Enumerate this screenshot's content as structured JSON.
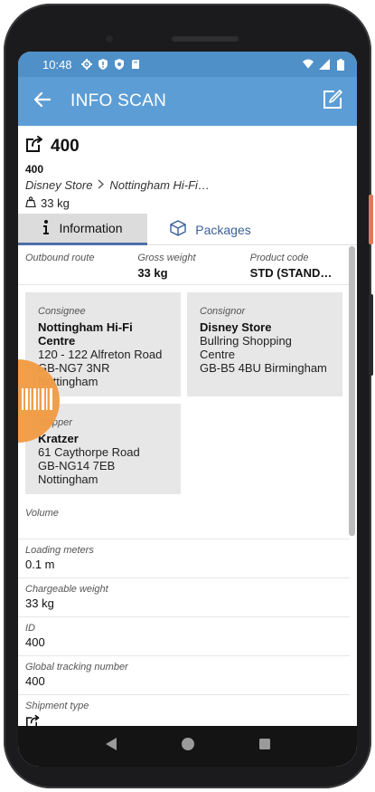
{
  "status_bar": {
    "time": "10:48"
  },
  "app_bar": {
    "title": "INFO SCAN"
  },
  "shipment": {
    "title": "400",
    "subtitle": "400",
    "origin": "Disney Store",
    "destination": "Nottingham Hi-Fi…",
    "weight": "33 kg"
  },
  "tabs": [
    {
      "label": "Information",
      "active": true
    },
    {
      "label": "Packages",
      "active": false
    }
  ],
  "summary": [
    {
      "label": "Outbound route",
      "value": ""
    },
    {
      "label": "Gross weight",
      "value": "33 kg"
    },
    {
      "label": "Product code",
      "value": "STD (STAND…"
    }
  ],
  "consignee": {
    "label": "Consignee",
    "name": "Nottingham Hi-Fi Centre",
    "line1": "120 - 122 Alfreton Road",
    "line2": "GB-NG7 3NR",
    "line3": "Nottingham"
  },
  "consignor": {
    "label": "Consignor",
    "name": "Disney Store",
    "line1": "Bullring Shopping Centre",
    "line2": "GB-B5 4BU Birmingham"
  },
  "shipper": {
    "label": "Shipper",
    "name": "Kratzer",
    "line1": "61 Caythorpe Road",
    "line2": "GB-NG14 7EB",
    "line3": "Nottingham"
  },
  "fields": [
    {
      "label": "Volume",
      "value": ""
    },
    {
      "label": "Loading meters",
      "value": "0.1 m"
    },
    {
      "label": "Chargeable weight",
      "value": "33 kg"
    },
    {
      "label": "ID",
      "value": "400"
    },
    {
      "label": "Global tracking number",
      "value": "400"
    },
    {
      "label": "Shipment type",
      "value": ""
    }
  ],
  "colors": {
    "status_bar": "#4f90c8",
    "app_bar": "#5d9dd5",
    "tab_indicator": "#4f6fa8",
    "scan_fab": "#f29c45"
  },
  "icons": {
    "back": "arrow-left-icon",
    "edit": "edit-note-icon",
    "shipment": "shipment-arrow-icon",
    "weight": "weight-icon",
    "info": "info-icon",
    "packages": "box-icon",
    "scan": "barcode-icon"
  }
}
